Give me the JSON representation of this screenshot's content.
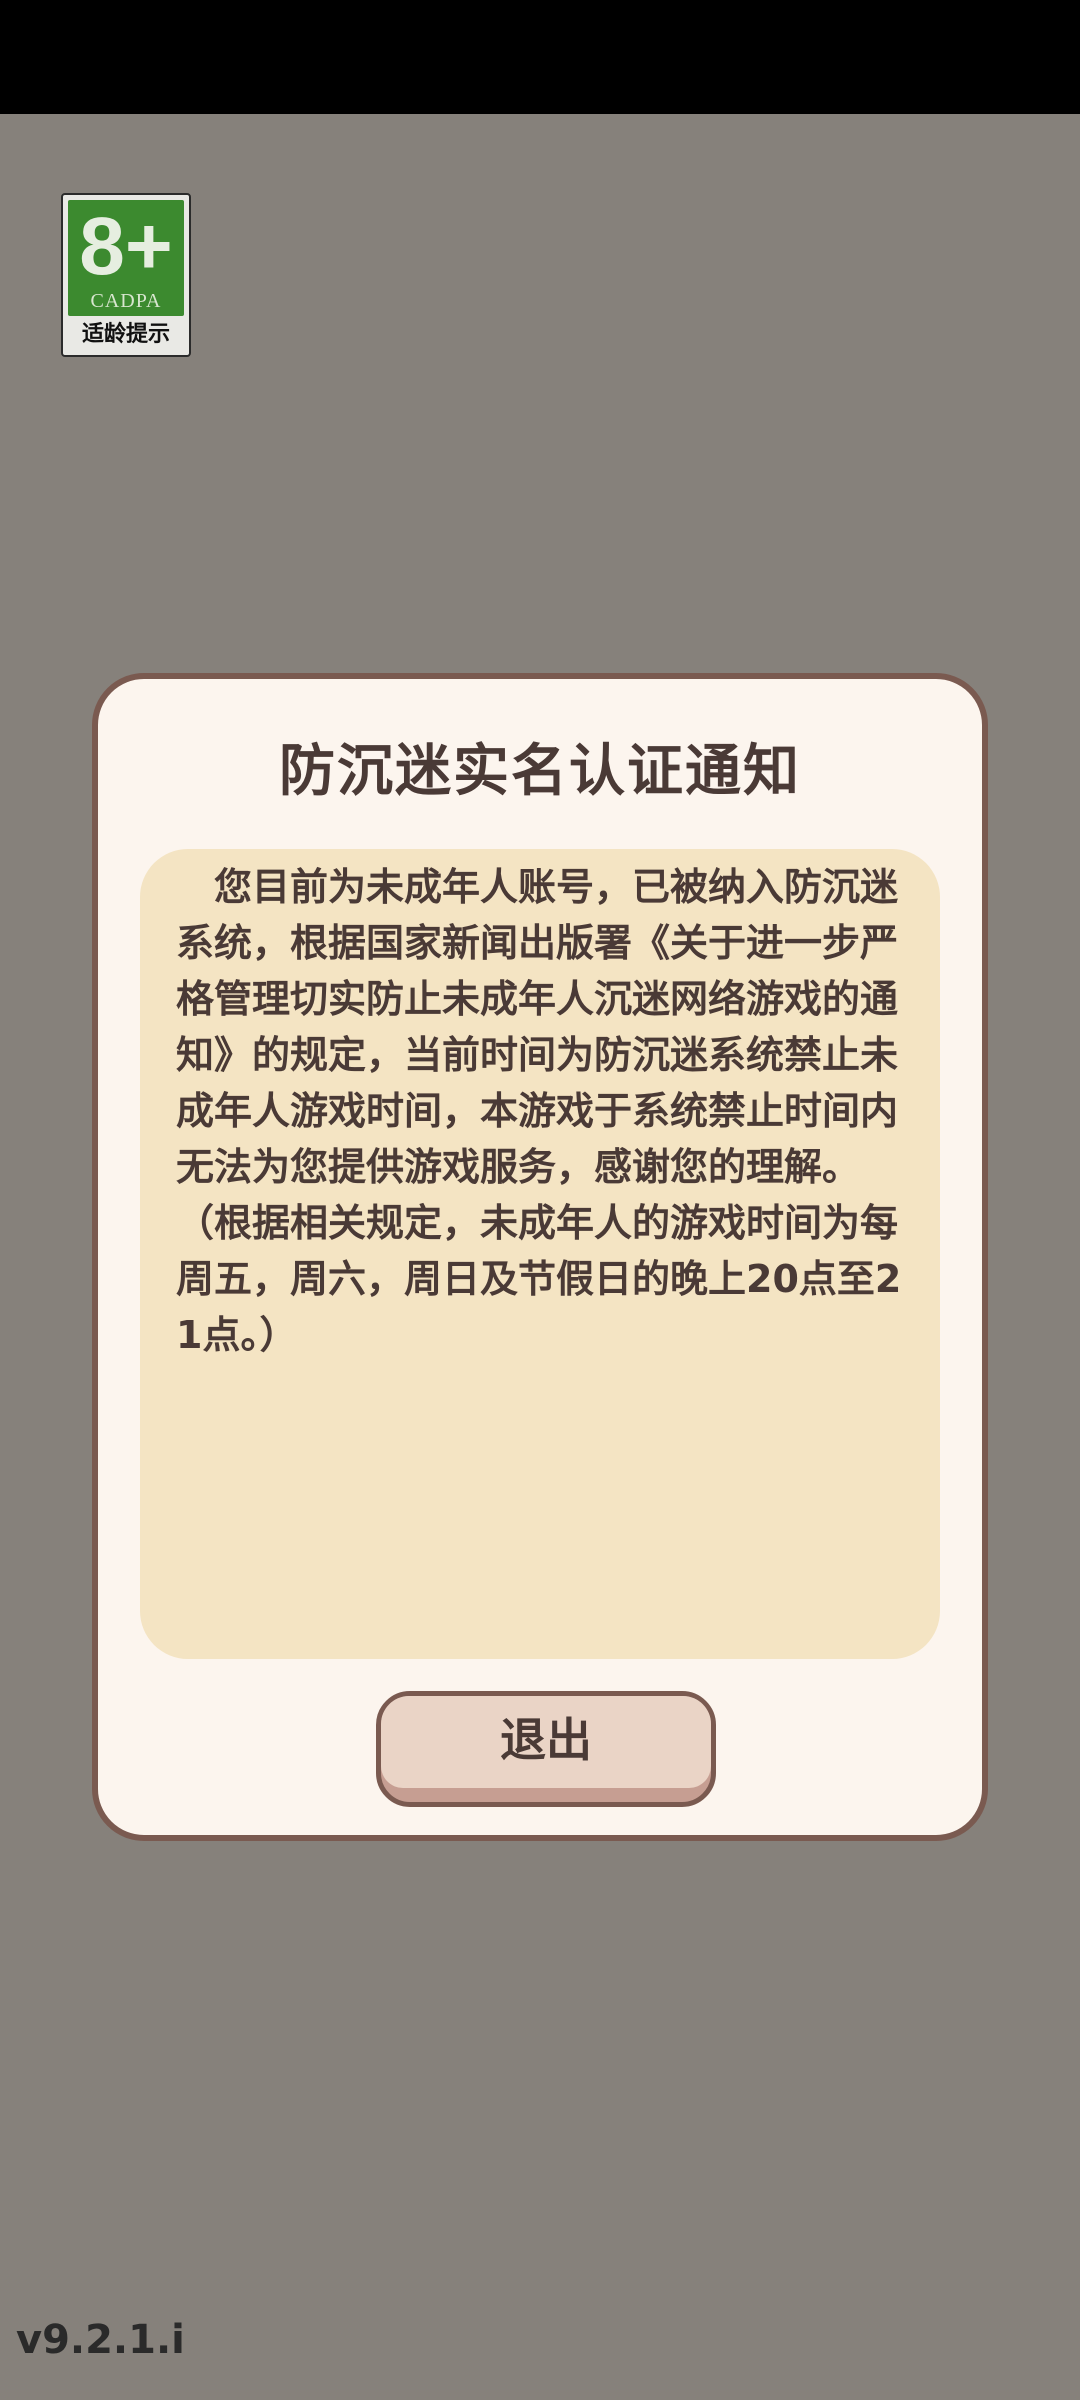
{
  "age_rating": {
    "age": "8+",
    "org": "CADPA",
    "tip": "适龄提示",
    "color": "#3c8a2f"
  },
  "dialog": {
    "title": "防沉迷实名认证通知",
    "notice": "您目前为未成年人账号，已被纳入防沉迷系统，根据国家新闻出版署《关于进一步严格管理切实防止未成年人沉迷网络游戏的通知》的规定，当前时间为防沉迷系统禁止未成年人游戏时间，本游戏于系统禁止时间内无法为您提供游戏服务，感谢您的理解。（根据相关规定，未成年人的游戏时间为每周五，周六，周日及节假日的晚上20点至21点。）",
    "exit_label": "退出"
  },
  "version": "v9.2.1.i",
  "colors": {
    "overlay": "#86817b",
    "dialog_bg": "#fcf5ee",
    "dialog_border": "#7a5a50",
    "notice_bg": "#f4e4c3",
    "text": "#4a3a36"
  }
}
